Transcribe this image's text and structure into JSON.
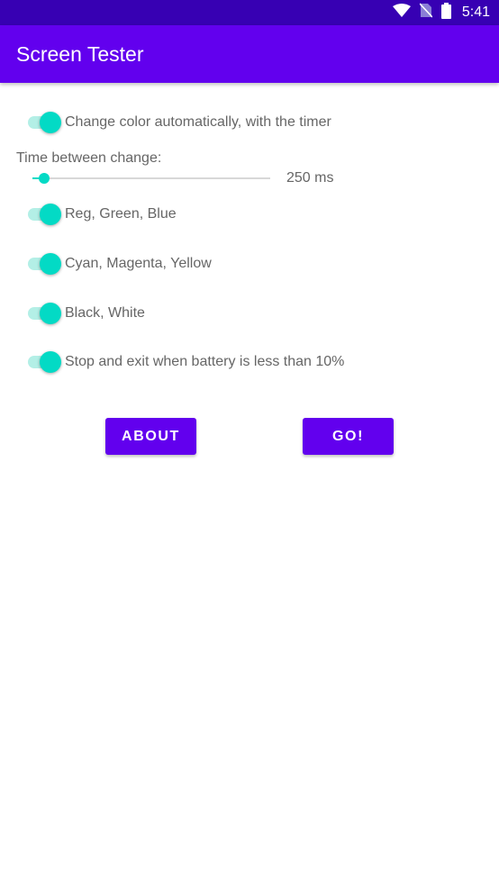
{
  "status_bar": {
    "time": "5:41",
    "icons": [
      "wifi-icon",
      "no-sim-icon",
      "battery-icon"
    ],
    "background": "#3700B3"
  },
  "app_bar": {
    "title": "Screen Tester",
    "background": "#6200EE"
  },
  "options": {
    "auto_change": {
      "label": "Change color automatically, with the timer",
      "checked": true
    },
    "rgb": {
      "label": "Reg, Green, Blue",
      "checked": true
    },
    "cmy": {
      "label": "Cyan, Magenta, Yellow",
      "checked": true
    },
    "black_white": {
      "label": "Black, White",
      "checked": true
    },
    "battery_exit": {
      "label": "Stop and exit when battery is less than 10%",
      "checked": true
    }
  },
  "slider": {
    "title": "Time between change:",
    "value_text": "250 ms",
    "fraction": 0.05
  },
  "buttons": {
    "about": "ABOUT",
    "go": "GO!"
  },
  "colors": {
    "accent": "#03DAC5",
    "primary": "#6200EE",
    "primary_dark": "#3700B3",
    "text_secondary": "#666666"
  }
}
